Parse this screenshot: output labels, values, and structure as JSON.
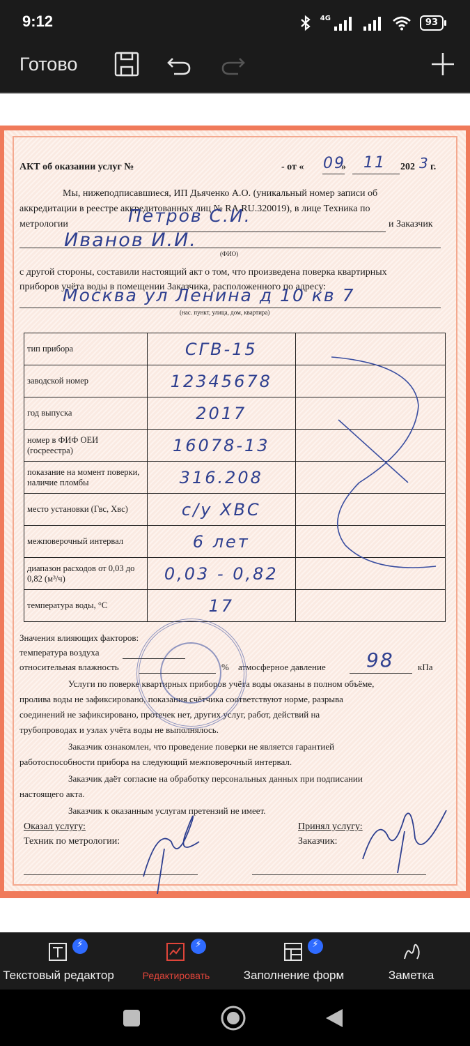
{
  "status": {
    "time": "9:12",
    "network": "4G",
    "battery": "93"
  },
  "toolbar": {
    "done_label": "Готово"
  },
  "document": {
    "title": "АКТ об оказании услуг  №",
    "date_prefix": "-    от «",
    "date_day": "09",
    "date_sep": "»",
    "date_month": "11",
    "date_year_prefix": "202",
    "date_year_digit": "3",
    "date_suffix": "г.",
    "intro_line1": "Мы, нижеподписавшиеся, ИП Дьяченко А.О. (уникальный номер записи об",
    "intro_line2": "аккредитации в реестре аккредитованных лиц № RA.RU.320019), в лице Техника по",
    "intro_line3_left": "метрологии",
    "intro_line3_right": "и Заказчик",
    "technician_handwritten": "Петров С.И.",
    "customer_handwritten": "Иванов И.И.",
    "fio_caption": "(ФИО)",
    "other_line1": "с другой стороны, составили настоящий акт о том, что произведена поверка квартирных",
    "other_line2": "приборов учёта воды в помещении Заказчика, расположенного по адресу:",
    "address_handwritten": "Москва  ул Ленина  д 10  кв 7",
    "address_caption": "(нас. пункт, улица, дом, квартира)",
    "table": [
      {
        "label": "тип прибора",
        "value": "СГВ-15"
      },
      {
        "label": "заводской номер",
        "value": "12345678"
      },
      {
        "label": "год выпуска",
        "value": "2017"
      },
      {
        "label": "номер в ФИФ ОЕИ (госреестра)",
        "value": "16078-13"
      },
      {
        "label": "показание на момент поверки, наличие пломбы",
        "value": "316.208"
      },
      {
        "label": "место установки (Гвс, Хвс)",
        "value": "с/у ХВС"
      },
      {
        "label": "межповерочный интервал",
        "value": "6 лет"
      },
      {
        "label": "диапазон расходов от   0,03  до  0,82  (м³/ч)",
        "value": "0,03 - 0,82"
      },
      {
        "label": "температура воды, °С",
        "value": "17"
      }
    ],
    "factors_title": "Значения влияющих факторов:",
    "air_temp_label": "температура воздуха",
    "humidity_label": "относительная влажность",
    "humidity_unit": "%",
    "pressure_label": "атмосферное давление",
    "pressure_value": "98",
    "pressure_unit": "кПа",
    "p1_l1": "Услуги по поверке квартирных приборов учёта воды оказаны в полном объёме,",
    "p1_l2": "пролива воды не зафиксировано, показания счётчика соответствуют норме, разрыва",
    "p1_l3": "соединений не зафиксировано, протечек нет, других услуг, работ, действий на",
    "p1_l4": "трубопроводах и узлах учёта воды не выполнялось.",
    "p2_l1": "Заказчик ознакомлен, что проведение поверки не является гарантией",
    "p2_l2": "работоспособности прибора на следующий межповерочный интервал.",
    "p3_l1": "Заказчик даёт согласие на обработку персональных данных при подписании",
    "p3_l2": "настоящего акта.",
    "p4": "Заказчик к оказанным услугам претензий не имеет.",
    "provided_label": "Оказал услугу:",
    "tech_label": "Техник по метрологии:",
    "accepted_label": "Принял услугу:",
    "customer_label": "Заказчик:"
  },
  "bottom_tabs": [
    {
      "label": "Текстовый редактор",
      "active": false
    },
    {
      "label": "Редактировать",
      "active": true
    },
    {
      "label": "Заполнение форм",
      "active": false
    },
    {
      "label": "Заметка",
      "active": false
    }
  ],
  "colors": {
    "accent": "#e0453a",
    "badge": "#2f6bff",
    "ink": "#2e3f8f",
    "border": "#f07a5a"
  }
}
